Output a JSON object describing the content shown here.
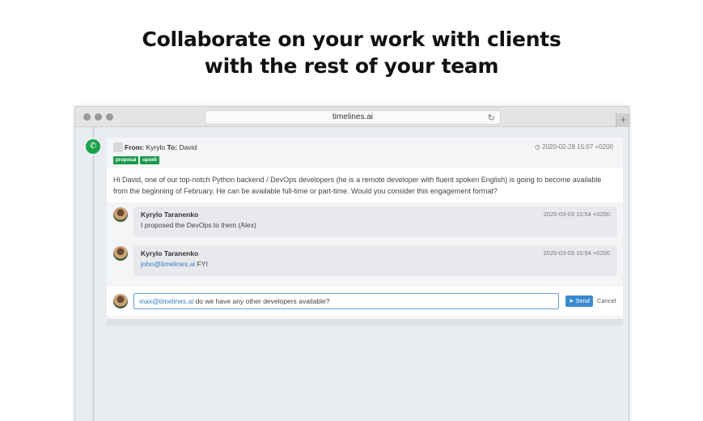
{
  "headline": {
    "line1": "Collaborate on your work with clients",
    "line2": "with the rest of your team"
  },
  "browser": {
    "url": "timelines.ai",
    "reload_icon": "reload-icon",
    "new_tab_label": "+"
  },
  "message": {
    "channel_icon": "whatsapp-icon",
    "from_label": "From:",
    "from_name": "Kyrylo",
    "to_label": "To:",
    "to_name": "David",
    "clock_icon": "clock-icon",
    "date": "2020-02-28 15:07 +0200",
    "tags": [
      "proposal",
      "upsell"
    ],
    "body": "Hi David, one of our top-notch Python backend / DevOps developers (he is a remote developer with fluent spoken English) is going to become available from the beginning of February. He can be available full-time or part-time. Would you consider this engagement format?"
  },
  "comments": [
    {
      "author": "Kyrylo Taranenko",
      "date": "2020-03-03 10:54 +0200",
      "mention": "",
      "text": "I proposed the DevOps to them (Alex)"
    },
    {
      "author": "Kyrylo Taranenko",
      "date": "2020-03-03 10:54 +0200",
      "mention": "john@timelines.ai",
      "text": " FYI"
    }
  ],
  "reply": {
    "mention": "max@timelines.ai",
    "text": " do we have any other developers available?",
    "send_label": "Send",
    "send_icon": "paper-plane-icon",
    "cancel_label": "Cancel"
  },
  "colors": {
    "tag_green": "#1a9a4a",
    "whatsapp_green": "#1aa34a",
    "send_blue": "#3a8ad0",
    "mention_blue": "#3a7ec2"
  }
}
